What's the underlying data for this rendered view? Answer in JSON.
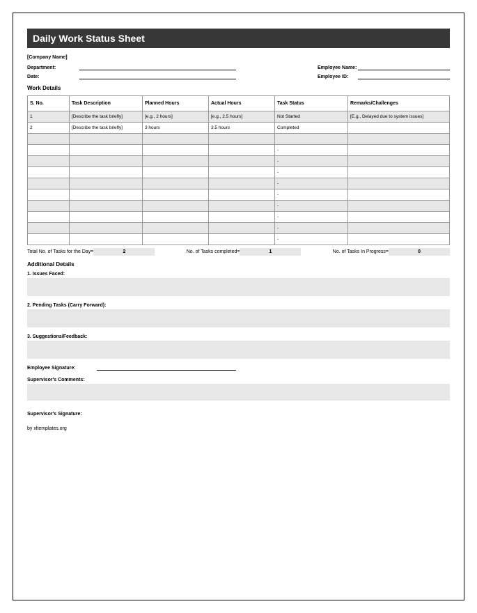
{
  "title": "Daily Work Status Sheet",
  "header": {
    "company_placeholder": "[Company Name]",
    "department_label": "Department:",
    "date_label": "Date:",
    "employee_name_label": "Employee Name:",
    "employee_id_label": "Employee ID:"
  },
  "work_details": {
    "heading": "Work Details",
    "columns": {
      "sno": "S. No.",
      "desc": "Task Description",
      "planned": "Planned Hours",
      "actual": "Actual Hours",
      "status": "Task Status",
      "remarks": "Remarks/Challenges"
    },
    "rows": [
      {
        "sno": "1",
        "desc": "[Describe the task briefly]",
        "planned": "[e.g., 2 hours]",
        "actual": "[e.g., 2.5 hours]",
        "status": "Not Started",
        "remarks": "[E.g., Delayed due to system issues]"
      },
      {
        "sno": "2",
        "desc": "[Describe the task briefly]",
        "planned": "3 hours",
        "actual": "3.5 hours",
        "status": "Completed",
        "remarks": ""
      },
      {
        "sno": "",
        "desc": "",
        "planned": "",
        "actual": "",
        "status": "",
        "remarks": ""
      },
      {
        "sno": "",
        "desc": "",
        "planned": "",
        "actual": "",
        "status": "-",
        "remarks": ""
      },
      {
        "sno": "",
        "desc": "",
        "planned": "",
        "actual": "",
        "status": "-",
        "remarks": ""
      },
      {
        "sno": "",
        "desc": "",
        "planned": "",
        "actual": "",
        "status": "-",
        "remarks": ""
      },
      {
        "sno": "",
        "desc": "",
        "planned": "",
        "actual": "",
        "status": "-",
        "remarks": ""
      },
      {
        "sno": "",
        "desc": "",
        "planned": "",
        "actual": "",
        "status": "-",
        "remarks": ""
      },
      {
        "sno": "",
        "desc": "",
        "planned": "",
        "actual": "",
        "status": "-",
        "remarks": ""
      },
      {
        "sno": "",
        "desc": "",
        "planned": "",
        "actual": "",
        "status": "-",
        "remarks": ""
      },
      {
        "sno": "",
        "desc": "",
        "planned": "",
        "actual": "",
        "status": "-",
        "remarks": ""
      },
      {
        "sno": "",
        "desc": "",
        "planned": "",
        "actual": "",
        "status": "-",
        "remarks": ""
      }
    ]
  },
  "totals": {
    "total_label": "Total No. of Tasks for the Day=",
    "total_value": "2",
    "completed_label": "No. of Tasks completed=",
    "completed_value": "1",
    "progress_label": "No. of Tasks In Progress=",
    "progress_value": "0"
  },
  "additional": {
    "heading": "Additional Details",
    "issues_label": "1. Issues Faced:",
    "pending_label": "2. Pending Tasks (Carry Forward):",
    "suggestions_label": "3. Suggestions/Feedback:"
  },
  "signatures": {
    "employee_label": "Employee Signature:",
    "supervisor_comments_label": "Supervisor's Comments:",
    "supervisor_signature_label": "Supervisor's Signature:"
  },
  "footer": "by xltemplates.org"
}
